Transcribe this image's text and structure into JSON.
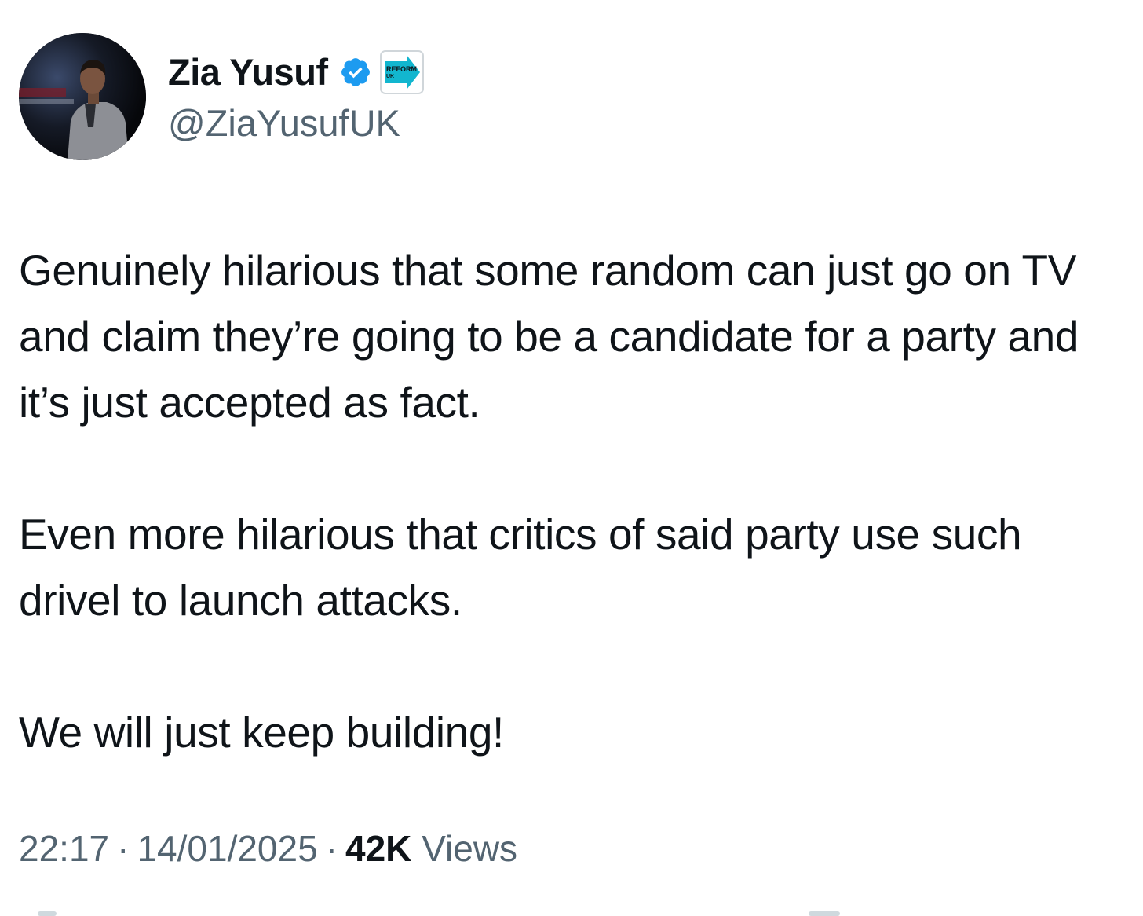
{
  "author": {
    "display_name": "Zia Yusuf",
    "handle": "@ZiaYusufUK",
    "verified": true,
    "verified_icon": "verified-badge-icon",
    "affiliation_badge_text": "REFORM UK",
    "affiliation_badge_line1": "REFORM",
    "affiliation_badge_line2": "UK",
    "affiliation_color": "#12b6cf"
  },
  "tweet": {
    "paragraphs": [
      "Genuinely hilarious that some random can just go on TV and claim they’re going to be a candidate for a party and it’s just accepted as fact.",
      "Even more hilarious that critics of said party use such drivel to launch attacks.",
      "We will just keep building!"
    ]
  },
  "meta": {
    "time": "22:17",
    "date": "14/01/2025",
    "views_count": "42K",
    "views_label": "Views",
    "separator": "·"
  },
  "colors": {
    "text_primary": "#0f1419",
    "text_secondary": "#536471",
    "verified_blue": "#1d9bf0",
    "background": "#ffffff"
  }
}
